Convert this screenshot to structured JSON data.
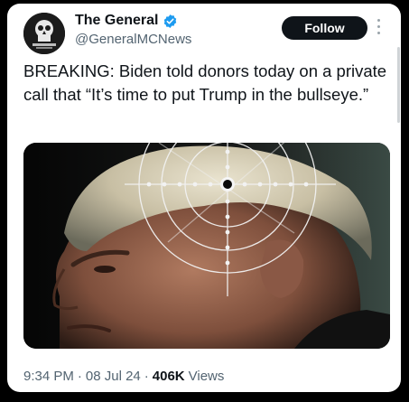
{
  "author": {
    "display_name": "The General",
    "handle": "@GeneralMCNews",
    "verified": true
  },
  "follow_button": {
    "label": "Follow"
  },
  "tweet": {
    "text": "BREAKING: Biden told donors today on a private call that “It’s time to put Trump in the bullseye.”"
  },
  "meta": {
    "time": "9:34 PM",
    "separator_1": "·",
    "date": "08 Jul 24",
    "separator_2": "·",
    "views_count": "406K",
    "views_label": "Views"
  },
  "colors": {
    "background": "#000000",
    "card": "#ffffff",
    "text_primary": "#0f1419",
    "text_secondary": "#536471",
    "verified_blue": "#1d9bf0",
    "follow_bg": "#0f1419"
  },
  "icons": {
    "verified": "verified-badge-icon",
    "more": "more-vertical-icon"
  }
}
